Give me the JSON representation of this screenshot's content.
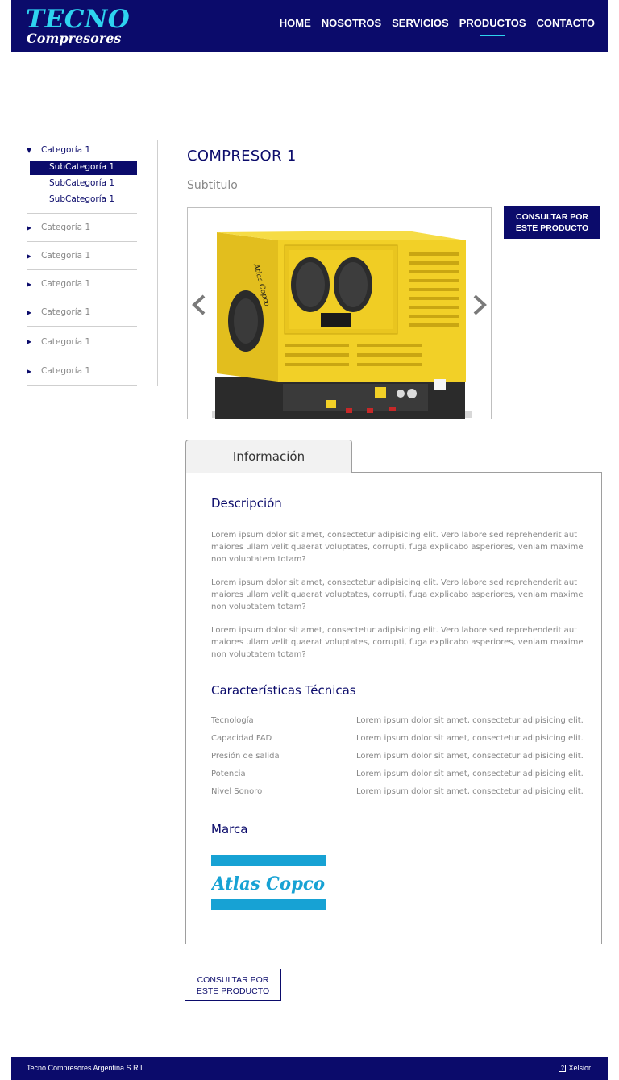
{
  "header": {
    "logo_top": "TECNO",
    "logo_bottom": "Compresores",
    "nav": [
      "HOME",
      "NOSOTROS",
      "SERVICIOS",
      "PRODUCTOS",
      "CONTACTO"
    ],
    "active_nav": "PRODUCTOS"
  },
  "sidebar": {
    "open_category": {
      "label": "Categoría 1",
      "subcategories": [
        "SubCategoría 1",
        "SubCategoría 1",
        "SubCategoría 1"
      ]
    },
    "categories": [
      "Categoría 1",
      "Categoría 1",
      "Categoría 1",
      "Categoría 1",
      "Categoría 1",
      "Categoría 1"
    ]
  },
  "product": {
    "title": "COMPRESOR 1",
    "subtitle": "Subtitulo",
    "consult_top_line1": "CONSULTAR POR",
    "consult_top_line2": "ESTE PRODUCTO",
    "machine_brand_mark": "Atlas Copco"
  },
  "tab": {
    "label": "Información"
  },
  "description": {
    "heading": "Descripción",
    "paragraphs": [
      "Lorem ipsum dolor sit amet, consectetur adipisicing elit. Vero labore sed reprehenderit aut maiores ullam velit quaerat voluptates, corrupti, fuga explicabo asperiores, veniam maxime non voluptatem totam?",
      "Lorem ipsum dolor sit amet, consectetur adipisicing elit. Vero labore sed reprehenderit aut maiores ullam velit quaerat voluptates, corrupti, fuga explicabo asperiores, veniam maxime non voluptatem totam?",
      "Lorem ipsum dolor sit amet, consectetur adipisicing elit. Vero labore sed reprehenderit aut maiores ullam velit quaerat voluptates, corrupti, fuga explicabo asperiores, veniam maxime non voluptatem totam?"
    ]
  },
  "specs": {
    "heading": "Características Técnicas",
    "rows": [
      {
        "label": "Tecnología",
        "value": "Lorem ipsum dolor sit amet, consectetur adipisicing elit."
      },
      {
        "label": "Capacidad FAD",
        "value": "Lorem ipsum dolor sit amet, consectetur adipisicing elit."
      },
      {
        "label": "Presión de salida",
        "value": "Lorem ipsum dolor sit amet, consectetur adipisicing elit."
      },
      {
        "label": "Potencia",
        "value": "Lorem ipsum dolor sit amet, consectetur adipisicing elit."
      },
      {
        "label": "Nivel Sonoro",
        "value": "Lorem ipsum dolor sit amet, consectetur adipisicing elit."
      }
    ]
  },
  "brand": {
    "heading": "Marca",
    "logo_text": "Atlas Copco"
  },
  "consult_bottom": {
    "line1": "CONSULTAR POR",
    "line2": "ESTE PRODUCTO"
  },
  "footer": {
    "company": "Tecno Compresores Argentina S.R.L",
    "credit_icon": "?",
    "credit": "Xelsior"
  },
  "colors": {
    "navy": "#0b0b6b",
    "cyan": "#2ed3ef",
    "yellow": "#f2d027",
    "atlas_blue": "#17a2d4"
  }
}
